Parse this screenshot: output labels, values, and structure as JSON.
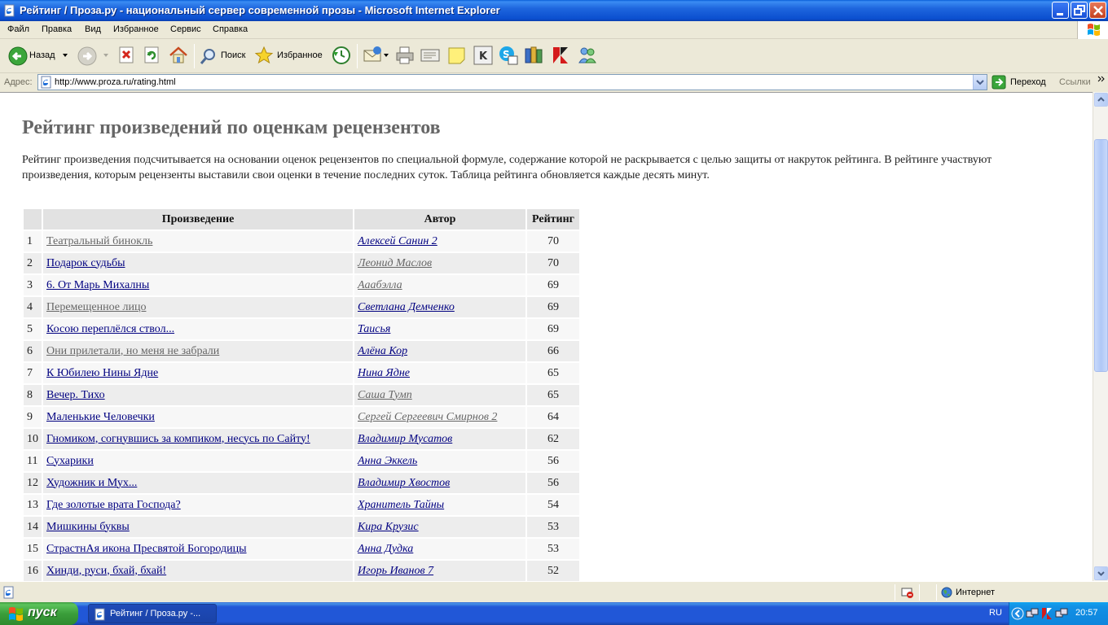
{
  "window": {
    "title": "Рейтинг / Проза.ру - национальный сервер современной прозы - Microsoft Internet Explorer"
  },
  "menu": [
    "Файл",
    "Правка",
    "Вид",
    "Избранное",
    "Сервис",
    "Справка"
  ],
  "toolbar": {
    "back_label": "Назад",
    "search_label": "Поиск",
    "favorites_label": "Избранное"
  },
  "address": {
    "label": "Адрес:",
    "url": "http://www.proza.ru/rating.html",
    "go_label": "Переход",
    "links_label": "Ссылки"
  },
  "page": {
    "title": "Рейтинг произведений по оценкам рецензентов",
    "description": "Рейтинг произведения подсчитывается на основании оценок рецензентов по специальной формуле, содержание которой не раскрывается с целью защиты от накруток рейтинга. В рейтинге участвуют произведения, которым рецензенты выставили свои оценки в течение последних суток. Таблица рейтинга обновляется каждые десять минут.",
    "table": {
      "headers": [
        "",
        "Произведение",
        "Автор",
        "Рейтинг"
      ],
      "rows": [
        {
          "n": "1",
          "work": "Театральный бинокль",
          "author": "Алексей Санин 2",
          "score": "70",
          "work_visited": true,
          "author_visited": false
        },
        {
          "n": "2",
          "work": "Подарок судьбы",
          "author": "Леонид Маслов",
          "score": "70",
          "work_visited": false,
          "author_visited": true
        },
        {
          "n": "3",
          "work": "6. От Марь Михалны",
          "author": "Аaабэлла",
          "score": "69",
          "work_visited": false,
          "author_visited": true
        },
        {
          "n": "4",
          "work": "Перемещенное лицо",
          "author": "Светлана Демченко",
          "score": "69",
          "work_visited": true,
          "author_visited": false
        },
        {
          "n": "5",
          "work": "Косою переплёлся ствол...",
          "author": "Таисья",
          "score": "69",
          "work_visited": false,
          "author_visited": false
        },
        {
          "n": "6",
          "work": "Они прилетали, но меня не забрали",
          "author": "Алёна Кор",
          "score": "66",
          "work_visited": true,
          "author_visited": false
        },
        {
          "n": "7",
          "work": "К Юбилею Нины Ядне",
          "author": "Нина Ядне",
          "score": "65",
          "work_visited": false,
          "author_visited": false
        },
        {
          "n": "8",
          "work": "Вечер. Тихо",
          "author": "Саша Тумп",
          "score": "65",
          "work_visited": false,
          "author_visited": true
        },
        {
          "n": "9",
          "work": "Маленькие Человечки",
          "author": "Сергей Сергеевич Смирнов 2",
          "score": "64",
          "work_visited": false,
          "author_visited": true
        },
        {
          "n": "10",
          "work": "Гномиком, согнувшись за компиком, несусь по Сайту!",
          "author": "Владимир Мусатов",
          "score": "62",
          "work_visited": false,
          "author_visited": false
        },
        {
          "n": "11",
          "work": "Сухарики",
          "author": "Анна Эккель",
          "score": "56",
          "work_visited": false,
          "author_visited": false
        },
        {
          "n": "12",
          "work": "Художник и Мух...",
          "author": "Владимир Хвостов",
          "score": "56",
          "work_visited": false,
          "author_visited": false
        },
        {
          "n": "13",
          "work": "Где золотые врата Господа?",
          "author": "Хранитель Тайны",
          "score": "54",
          "work_visited": false,
          "author_visited": false
        },
        {
          "n": "14",
          "work": "Мишкины буквы",
          "author": "Кира Крузис",
          "score": "53",
          "work_visited": false,
          "author_visited": false
        },
        {
          "n": "15",
          "work": "СтрастнАя икона Пресвятой Богородицы",
          "author": "Анна Дудка",
          "score": "53",
          "work_visited": false,
          "author_visited": false
        },
        {
          "n": "16",
          "work": "Хинди, руси, бхай, бхай!",
          "author": "Игорь Иванов 7",
          "score": "52",
          "work_visited": false,
          "author_visited": false
        }
      ]
    }
  },
  "status": {
    "zone": "Интернет"
  },
  "taskbar": {
    "start_label": "пуск",
    "task_label": "Рейтинг / Проза.ру -...",
    "lang": "RU",
    "clock": "20:57"
  },
  "colors": {
    "link": "#000080",
    "visited": "#666666",
    "title_gray": "#666666"
  }
}
